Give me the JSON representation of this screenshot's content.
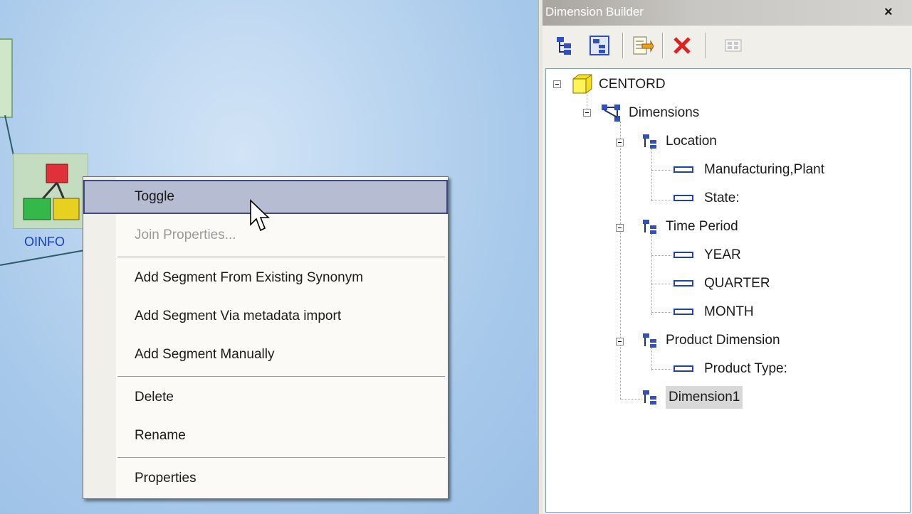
{
  "canvas": {
    "node_label": "OINFO"
  },
  "context_menu": {
    "items": [
      {
        "label": "Toggle",
        "state": "hover"
      },
      {
        "label": "Join Properties...",
        "state": "disabled"
      },
      {
        "label": "Add Segment From Existing Synonym"
      },
      {
        "label": "Add Segment Via metadata import"
      },
      {
        "label": "Add Segment Manually"
      },
      {
        "label": "Delete"
      },
      {
        "label": "Rename"
      },
      {
        "label": "Properties"
      }
    ]
  },
  "panel": {
    "title": "Dimension Builder",
    "close_label": "×",
    "toolbar": [
      "add-dimension-icon",
      "add-hierarchy-icon",
      "edit-icon",
      "delete-icon",
      "properties-icon"
    ],
    "tree": {
      "root": "CENTORD",
      "dimensions_label": "Dimensions",
      "dimensions": [
        {
          "label": "Location",
          "levels": [
            "Manufacturing,Plant",
            "State:"
          ]
        },
        {
          "label": "Time Period",
          "levels": [
            "YEAR",
            "QUARTER",
            "MONTH"
          ]
        },
        {
          "label": "Product Dimension",
          "levels": [
            "Product Type:"
          ]
        },
        {
          "label": "Dimension1",
          "levels": [],
          "selected": true
        }
      ]
    }
  },
  "colors": {
    "canvas_bg": "#bcd6f0",
    "menu_hover": "#b6bdd2",
    "label_blue": "#1a3cc8",
    "delete_red": "#e02020"
  }
}
